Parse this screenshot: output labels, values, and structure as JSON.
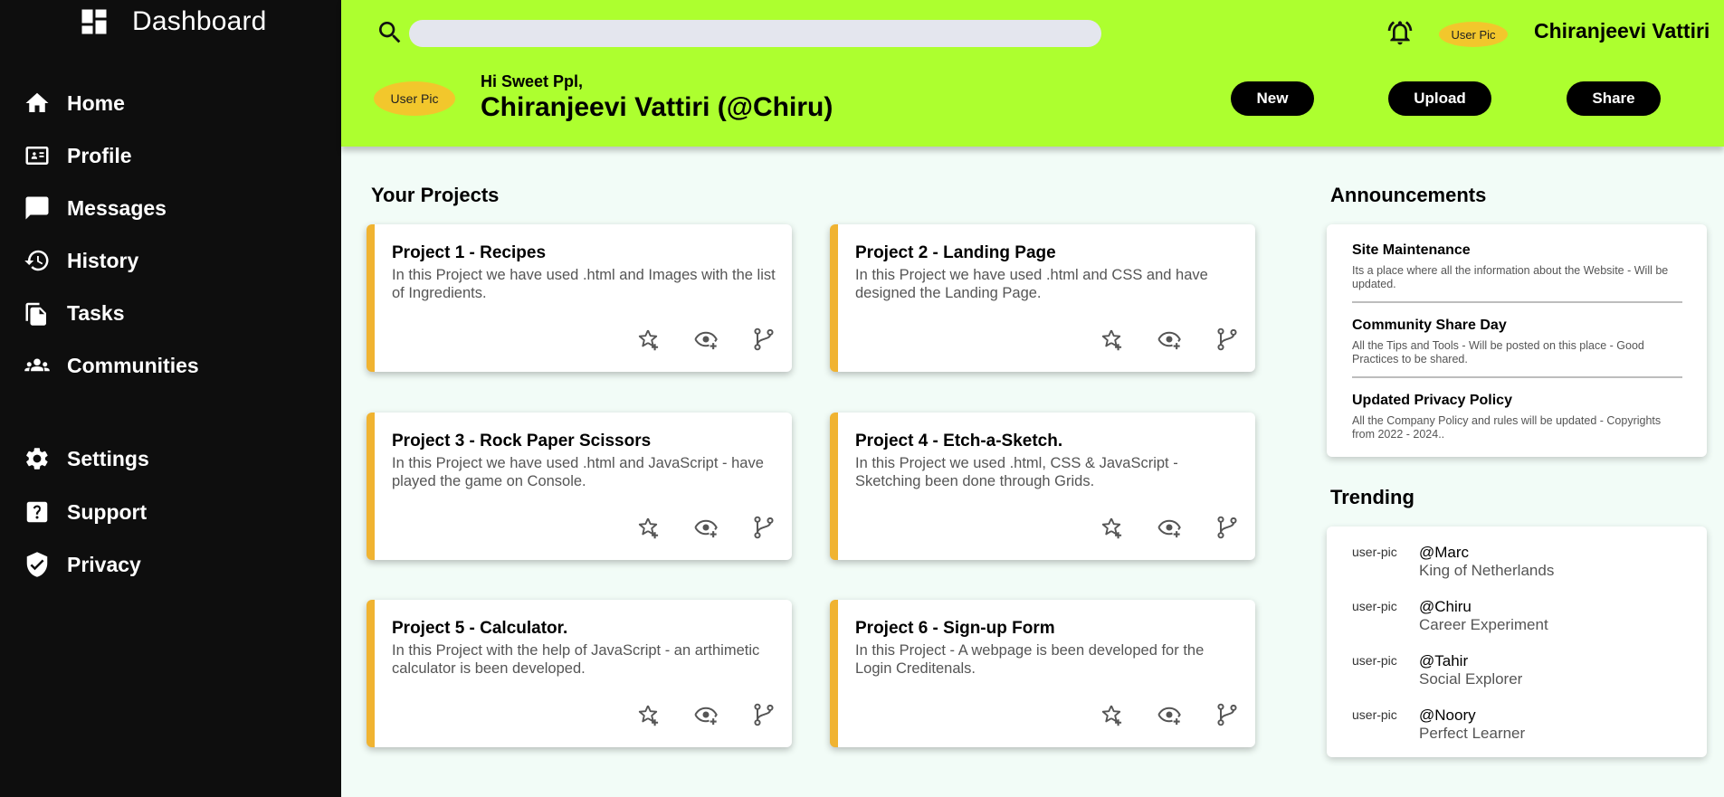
{
  "sidebar": {
    "brand_title": "Dashboard",
    "items": [
      {
        "label": "Home",
        "icon": "home-icon"
      },
      {
        "label": "Profile",
        "icon": "profile-card-icon"
      },
      {
        "label": "Messages",
        "icon": "message-icon"
      },
      {
        "label": "History",
        "icon": "history-icon"
      },
      {
        "label": "Tasks",
        "icon": "tasks-icon"
      },
      {
        "label": "Communities",
        "icon": "communities-icon"
      },
      {
        "label": "Settings",
        "icon": "gear-icon"
      },
      {
        "label": "Support",
        "icon": "help-icon"
      },
      {
        "label": "Privacy",
        "icon": "shield-icon"
      }
    ]
  },
  "header": {
    "search_placeholder": "",
    "user_pic_alt": "User Pic",
    "username": "Chiranjeevi Vattiri",
    "greeting": "Hi Sweet Ppl,",
    "full_name": "Chiranjeevi Vattiri (@Chiru)",
    "buttons": {
      "new": "New",
      "upload": "Upload",
      "share": "Share"
    }
  },
  "projects": {
    "title": "Your Projects",
    "cards": [
      {
        "title": "Project 1 - Recipes",
        "desc": "In this Project we have used .html and Images with the list of Ingredients."
      },
      {
        "title": "Project 2 - Landing Page",
        "desc": "In this Project we have used .html and CSS and have designed the Landing Page."
      },
      {
        "title": "Project 3 - Rock Paper Scissors",
        "desc": "In this Project we have used .html and JavaScript - have played the game on Console."
      },
      {
        "title": "Project 4 - Etch-a-Sketch.",
        "desc": "In this Project we used .html, CSS & JavaScript - Sketching been done through Grids."
      },
      {
        "title": "Project 5 - Calculator.",
        "desc": "In this Project with the help of JavaScript - an arthimetic calculator is been developed."
      },
      {
        "title": "Project 6 - Sign-up Form",
        "desc": "In this Project - A webpage is been developed for the Login Creditenals."
      }
    ]
  },
  "announcements": {
    "title": "Announcements",
    "items": [
      {
        "title": "Site Maintenance",
        "text": "Its a place where all the information about the Website - Will be updated."
      },
      {
        "title": "Community Share Day",
        "text": "All the Tips and Tools - Will be posted on this place - Good Practices to be shared."
      },
      {
        "title": "Updated Privacy Policy",
        "text": "All the Company Policy and rules will be updated - Copyrights from 2022 - 2024.."
      }
    ]
  },
  "trending": {
    "title": "Trending",
    "pic_alt": "user-pic",
    "items": [
      {
        "handle": "@Marc",
        "subtitle": "King of Netherlands"
      },
      {
        "handle": "@Chiru",
        "subtitle": "Career Experiment"
      },
      {
        "handle": "@Tahir",
        "subtitle": "Social Explorer"
      },
      {
        "handle": "@Noory",
        "subtitle": "Perfect Learner"
      }
    ]
  },
  "colors": {
    "sidebar_bg": "#0e0e0e",
    "header_bg": "#adff2f",
    "card_accent": "#f0b331",
    "page_bg": "#f2fcf7",
    "avatar_bg": "#f2c72c"
  }
}
